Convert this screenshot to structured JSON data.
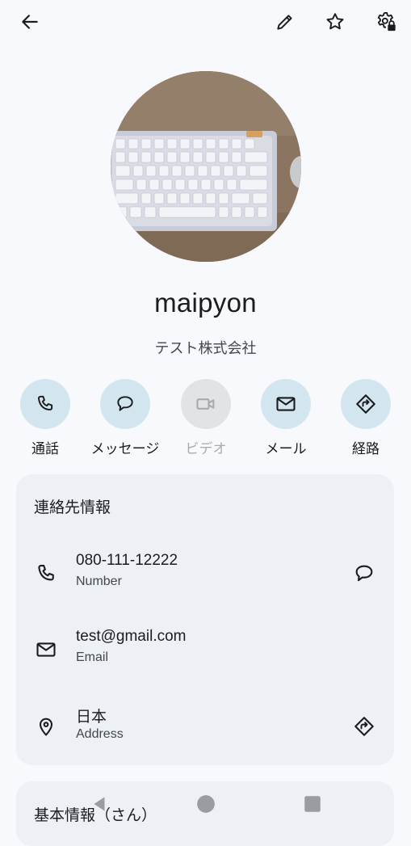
{
  "contact": {
    "name": "maipyon",
    "company": "テスト株式会社"
  },
  "actions": [
    {
      "label": "通話",
      "icon": "phone-icon"
    },
    {
      "label": "メッセージ",
      "icon": "message-icon"
    },
    {
      "label": "ビデオ",
      "icon": "video-icon",
      "disabled": true
    },
    {
      "label": "メール",
      "icon": "mail-icon"
    },
    {
      "label": "経路",
      "icon": "directions-icon"
    }
  ],
  "contact_info": {
    "title": "連絡先情報",
    "phone": {
      "value": "080-111-12222",
      "type": "Number"
    },
    "email": {
      "value": "test@gmail.com",
      "type": "Email"
    },
    "address": {
      "value": "日本",
      "type": "Address"
    }
  },
  "basic_info": {
    "title": "基本情報（さん）"
  },
  "colors": {
    "background": "#f7f9fc",
    "action_circle": "#d3e5ee",
    "card": "#edf0f4"
  }
}
